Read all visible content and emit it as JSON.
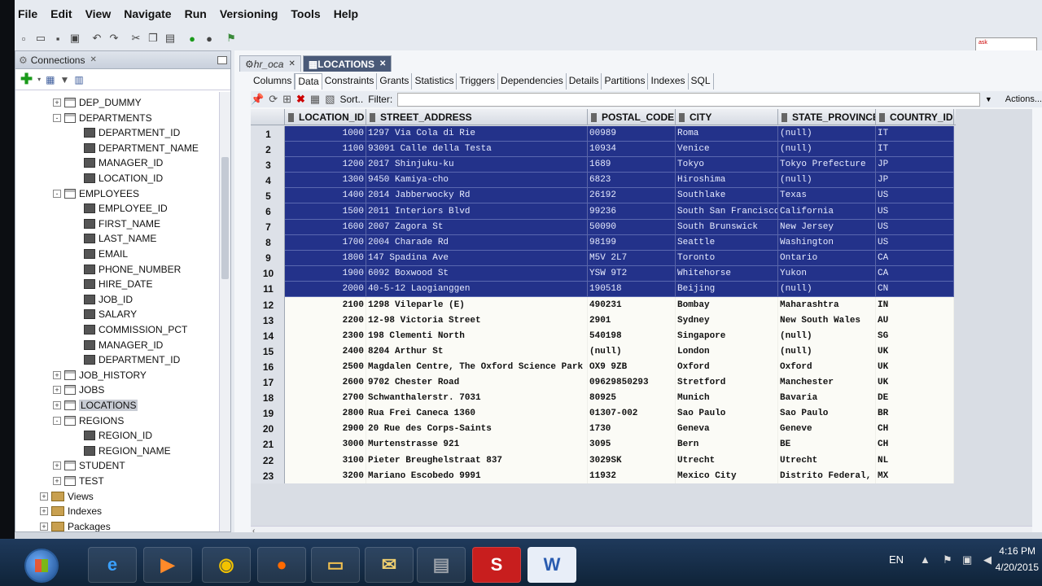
{
  "menu": [
    "File",
    "Edit",
    "View",
    "Navigate",
    "Run",
    "Versioning",
    "Tools",
    "Help"
  ],
  "mini_window_text": "ask",
  "connections_panel": {
    "tab_label": "Connections",
    "tree": [
      {
        "label": "DEP_DUMMY",
        "level": 2,
        "kind": "table",
        "exp": "+"
      },
      {
        "label": "DEPARTMENTS",
        "level": 2,
        "kind": "table",
        "exp": "-"
      },
      {
        "label": "DEPARTMENT_ID",
        "level": 3,
        "kind": "column"
      },
      {
        "label": "DEPARTMENT_NAME",
        "level": 3,
        "kind": "column"
      },
      {
        "label": "MANAGER_ID",
        "level": 3,
        "kind": "column"
      },
      {
        "label": "LOCATION_ID",
        "level": 3,
        "kind": "column"
      },
      {
        "label": "EMPLOYEES",
        "level": 2,
        "kind": "table",
        "exp": "-"
      },
      {
        "label": "EMPLOYEE_ID",
        "level": 3,
        "kind": "column"
      },
      {
        "label": "FIRST_NAME",
        "level": 3,
        "kind": "column"
      },
      {
        "label": "LAST_NAME",
        "level": 3,
        "kind": "column"
      },
      {
        "label": "EMAIL",
        "level": 3,
        "kind": "column"
      },
      {
        "label": "PHONE_NUMBER",
        "level": 3,
        "kind": "column"
      },
      {
        "label": "HIRE_DATE",
        "level": 3,
        "kind": "column"
      },
      {
        "label": "JOB_ID",
        "level": 3,
        "kind": "column"
      },
      {
        "label": "SALARY",
        "level": 3,
        "kind": "column"
      },
      {
        "label": "COMMISSION_PCT",
        "level": 3,
        "kind": "column"
      },
      {
        "label": "MANAGER_ID",
        "level": 3,
        "kind": "column"
      },
      {
        "label": "DEPARTMENT_ID",
        "level": 3,
        "kind": "column"
      },
      {
        "label": "JOB_HISTORY",
        "level": 2,
        "kind": "table",
        "exp": "+"
      },
      {
        "label": "JOBS",
        "level": 2,
        "kind": "table",
        "exp": "+"
      },
      {
        "label": "LOCATIONS",
        "level": 2,
        "kind": "table",
        "exp": "+",
        "selected": true
      },
      {
        "label": "REGIONS",
        "level": 2,
        "kind": "table",
        "exp": "-"
      },
      {
        "label": "REGION_ID",
        "level": 3,
        "kind": "column"
      },
      {
        "label": "REGION_NAME",
        "level": 3,
        "kind": "column"
      },
      {
        "label": "STUDENT",
        "level": 2,
        "kind": "table",
        "exp": "+"
      },
      {
        "label": "TEST",
        "level": 2,
        "kind": "table",
        "exp": "+"
      },
      {
        "label": "Views",
        "level": 1,
        "kind": "folder",
        "exp": "+"
      },
      {
        "label": "Indexes",
        "level": 1,
        "kind": "folder",
        "exp": "+"
      },
      {
        "label": "Packages",
        "level": 1,
        "kind": "folder",
        "exp": "+"
      }
    ]
  },
  "editor": {
    "tabs": [
      {
        "label": "hr_oca",
        "active": false
      },
      {
        "label": "LOCATIONS",
        "active": true
      }
    ],
    "subtabs": [
      "Columns",
      "Data",
      "Constraints",
      "Grants",
      "Statistics",
      "Triggers",
      "Dependencies",
      "Details",
      "Partitions",
      "Indexes",
      "SQL"
    ],
    "active_subtab": "Data",
    "toolbar": {
      "sort_label": "Sort..",
      "filter_label": "Filter:",
      "filter_value": "",
      "actions_label": "Actions..."
    }
  },
  "grid": {
    "columns": [
      "LOCATION_ID",
      "STREET_ADDRESS",
      "POSTAL_CODE",
      "CITY",
      "STATE_PROVINCE",
      "COUNTRY_ID"
    ],
    "selected_count": 11,
    "rows": [
      [
        "1",
        "1000",
        "1297 Via Cola di Rie",
        "00989",
        "Roma",
        "(null)",
        "IT"
      ],
      [
        "2",
        "1100",
        "93091 Calle della Testa",
        "10934",
        "Venice",
        "(null)",
        "IT"
      ],
      [
        "3",
        "1200",
        "2017 Shinjuku-ku",
        "1689",
        "Tokyo",
        "Tokyo Prefecture",
        "JP"
      ],
      [
        "4",
        "1300",
        "9450 Kamiya-cho",
        "6823",
        "Hiroshima",
        "(null)",
        "JP"
      ],
      [
        "5",
        "1400",
        "2014 Jabberwocky Rd",
        "26192",
        "Southlake",
        "Texas",
        "US"
      ],
      [
        "6",
        "1500",
        "2011 Interiors Blvd",
        "99236",
        "South San Francisco",
        "California",
        "US"
      ],
      [
        "7",
        "1600",
        "2007 Zagora St",
        "50090",
        "South Brunswick",
        "New Jersey",
        "US"
      ],
      [
        "8",
        "1700",
        "2004 Charade Rd",
        "98199",
        "Seattle",
        "Washington",
        "US"
      ],
      [
        "9",
        "1800",
        "147 Spadina Ave",
        "M5V 2L7",
        "Toronto",
        "Ontario",
        "CA"
      ],
      [
        "10",
        "1900",
        "6092 Boxwood St",
        "YSW 9T2",
        "Whitehorse",
        "Yukon",
        "CA"
      ],
      [
        "11",
        "2000",
        "40-5-12 Laogianggen",
        "190518",
        "Beijing",
        "(null)",
        "CN"
      ],
      [
        "12",
        "2100",
        "1298 Vileparle (E)",
        "490231",
        "Bombay",
        "Maharashtra",
        "IN"
      ],
      [
        "13",
        "2200",
        "12-98 Victoria Street",
        "2901",
        "Sydney",
        "New South Wales",
        "AU"
      ],
      [
        "14",
        "2300",
        "198 Clementi North",
        "540198",
        "Singapore",
        "(null)",
        "SG"
      ],
      [
        "15",
        "2400",
        "8204 Arthur St",
        "(null)",
        "London",
        "(null)",
        "UK"
      ],
      [
        "16",
        "2500",
        "Magdalen Centre, The Oxford Science Park",
        "OX9 9ZB",
        "Oxford",
        "Oxford",
        "UK"
      ],
      [
        "17",
        "2600",
        "9702 Chester Road",
        "09629850293",
        "Stretford",
        "Manchester",
        "UK"
      ],
      [
        "18",
        "2700",
        "Schwanthalerstr. 7031",
        "80925",
        "Munich",
        "Bavaria",
        "DE"
      ],
      [
        "19",
        "2800",
        "Rua Frei Caneca 1360",
        "01307-002",
        "Sao Paulo",
        "Sao Paulo",
        "BR"
      ],
      [
        "20",
        "2900",
        "20 Rue des Corps-Saints",
        "1730",
        "Geneva",
        "Geneve",
        "CH"
      ],
      [
        "21",
        "3000",
        "Murtenstrasse 921",
        "3095",
        "Bern",
        "BE",
        "CH"
      ],
      [
        "22",
        "3100",
        "Pieter Breughelstraat 837",
        "3029SK",
        "Utrecht",
        "Utrecht",
        "NL"
      ],
      [
        "23",
        "3200",
        "Mariano Escobedo 9991",
        "11932",
        "Mexico City",
        "Distrito Federal,",
        "MX"
      ]
    ]
  },
  "taskbar": {
    "apps": [
      {
        "name": "ie-icon",
        "glyph": "e",
        "color": "#3aa0ff"
      },
      {
        "name": "media-player-icon",
        "glyph": "▶",
        "color": "#ff8a2a"
      },
      {
        "name": "chrome-icon",
        "glyph": "◉",
        "color": "#f2c200"
      },
      {
        "name": "firefox-icon",
        "glyph": "●",
        "color": "#ff6a00"
      },
      {
        "name": "explorer-folder-icon",
        "glyph": "▭",
        "color": "#f0c050"
      },
      {
        "name": "outlook-icon",
        "glyph": "✉",
        "color": "#f0d070"
      },
      {
        "name": "database-icon",
        "glyph": "▤",
        "color": "#9aa0a8"
      },
      {
        "name": "s-app-icon",
        "glyph": "S",
        "color": "#ffffff",
        "bg": "#c81e1e"
      },
      {
        "name": "word-icon",
        "glyph": "W",
        "color": "#2a5cb0",
        "bg": "#e8eef8"
      }
    ],
    "language": "EN",
    "time": "4:16 PM",
    "date": "4/20/2015"
  }
}
